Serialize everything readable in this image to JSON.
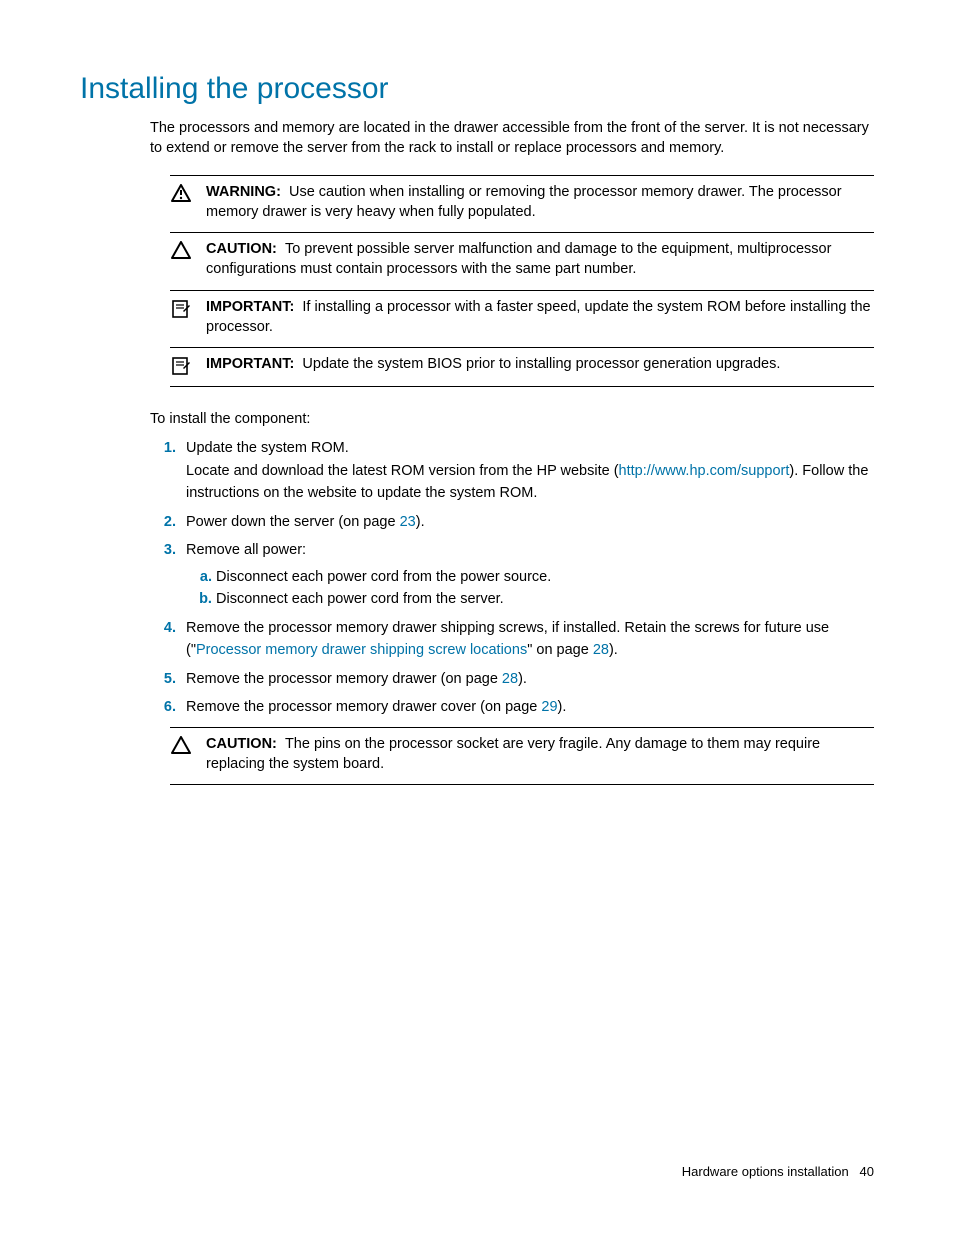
{
  "heading": "Installing the processor",
  "intro": "The processors and memory are located in the drawer accessible from the front of the server. It is not necessary to extend or remove the server from the rack to install or replace processors and memory.",
  "notes": [
    {
      "label": "WARNING:",
      "text": "Use caution when installing or removing the processor memory drawer. The processor memory drawer is very heavy when fully populated."
    },
    {
      "label": "CAUTION:",
      "text": "To prevent possible server malfunction and damage to the equipment, multiprocessor configurations must contain processors with the same part number."
    },
    {
      "label": "IMPORTANT:",
      "text": "If installing a processor with a faster speed, update the system ROM before installing the processor."
    },
    {
      "label": "IMPORTANT:",
      "text": "Update the system BIOS prior to installing processor generation upgrades."
    }
  ],
  "to_install": "To install the component:",
  "steps": {
    "s1_a": "Update the system ROM.",
    "s1_b": "Locate and download the latest ROM version from the HP website (",
    "s1_link": "http://www.hp.com/support",
    "s1_c": "). Follow the instructions on the website to update the system ROM.",
    "s2_a": "Power down the server (on page ",
    "s2_link": "23",
    "s2_b": ").",
    "s3": "Remove all power:",
    "s3a": "Disconnect each power cord from the power source.",
    "s3b": "Disconnect each power cord from the server.",
    "s4_a": "Remove the processor memory drawer shipping screws, if installed. Retain the screws for future use (\"",
    "s4_link1": "Processor memory drawer shipping screw locations",
    "s4_b": "\" on page ",
    "s4_link2": "28",
    "s4_c": ").",
    "s5_a": "Remove the processor memory drawer (on page ",
    "s5_link": "28",
    "s5_b": ").",
    "s6_a": "Remove the processor memory drawer cover (on page ",
    "s6_link": "29",
    "s6_b": ")."
  },
  "inline_caution": {
    "label": "CAUTION:",
    "text": "The pins on the processor socket are very fragile. Any damage to them may require replacing the system board."
  },
  "footer_text": "Hardware options installation",
  "footer_page": "40"
}
